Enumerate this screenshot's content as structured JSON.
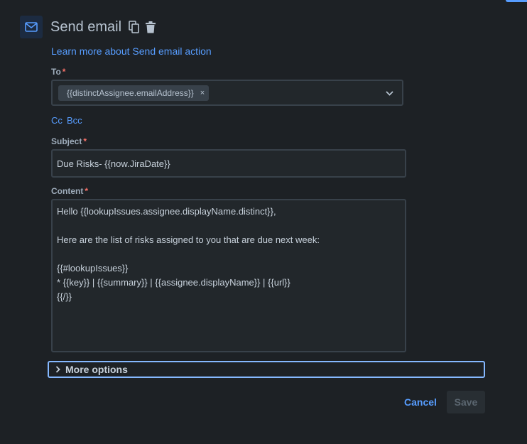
{
  "header": {
    "title": "Send email",
    "icon": "mail-icon",
    "actions": [
      {
        "icon": "copy-icon"
      },
      {
        "icon": "trash-icon"
      }
    ]
  },
  "learn_more_link": "Learn more about Send email action",
  "to_field": {
    "label": "To",
    "required_mark": "*",
    "selected_tag": "{{distinctAssignee.emailAddress}}",
    "remove_glyph": "×"
  },
  "cc_label": "Cc",
  "bcc_label": "Bcc",
  "subject_field": {
    "label": "Subject",
    "required_mark": "*",
    "value": "Due Risks- {{now.JiraDate}}"
  },
  "content_field": {
    "label": "Content",
    "required_mark": "*",
    "value": "Hello {{lookupIssues.assignee.displayName.distinct}},\n\nHere are the list of risks assigned to you that are due next week:\n\n{{#lookupIssues}}\n* {{key}} | {{summary}} | {{assignee.displayName}} | {{url}}\n{{/}}"
  },
  "more_options_label": "More options",
  "buttons": {
    "cancel": "Cancel",
    "save": "Save"
  },
  "colors": {
    "background": "#1d2125",
    "link": "#579dff",
    "required": "#f87168",
    "focus_border": "#85b8ff"
  }
}
